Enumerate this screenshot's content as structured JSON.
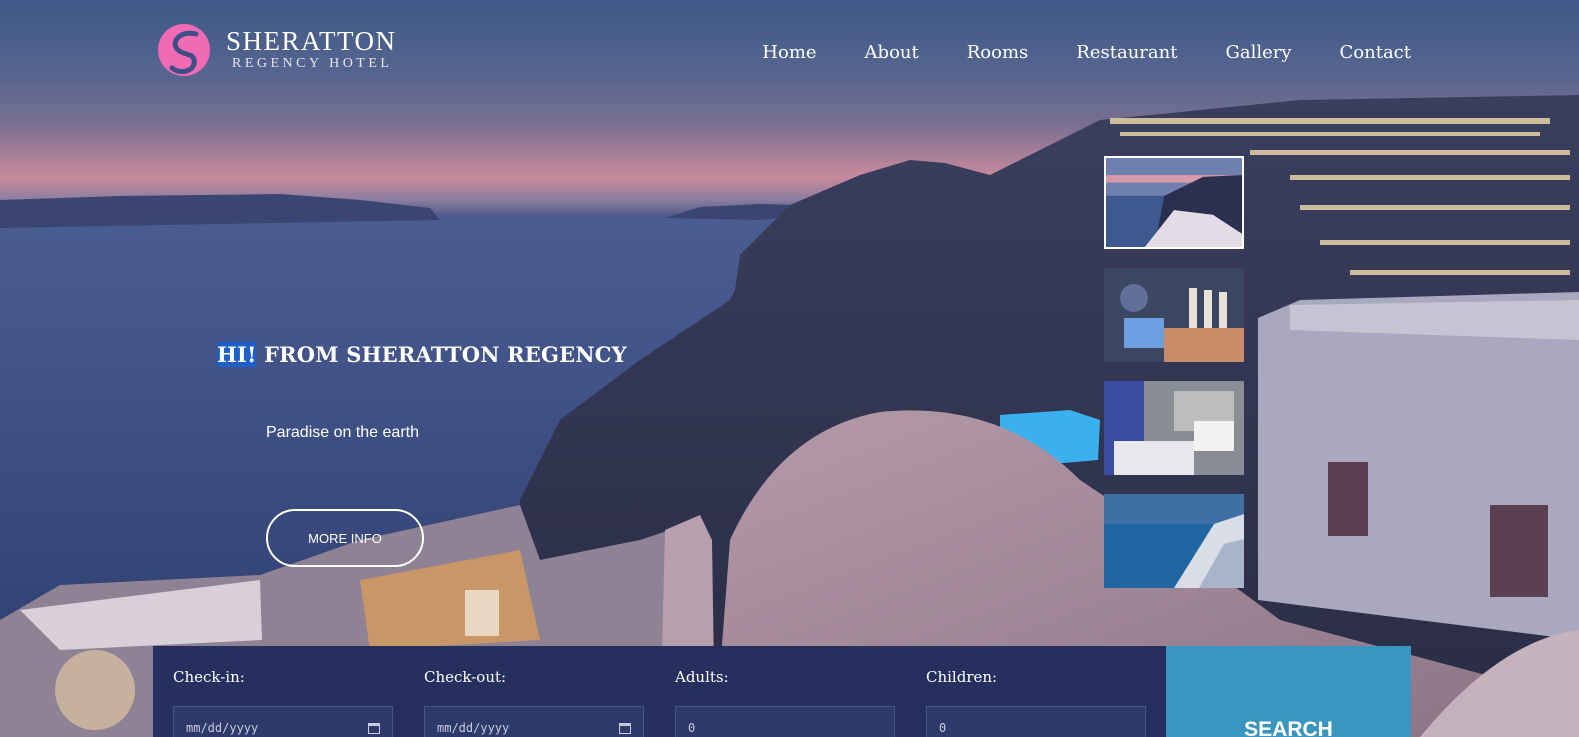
{
  "brand": {
    "name": "SHERATTON",
    "tagline": "REGENCY HOTEL",
    "accent_color": "#f06bb4"
  },
  "nav": {
    "items": [
      {
        "label": "Home"
      },
      {
        "label": "About"
      },
      {
        "label": "Rooms"
      },
      {
        "label": "Restaurant"
      },
      {
        "label": "Gallery"
      },
      {
        "label": "Contact"
      }
    ]
  },
  "hero": {
    "title_highlight": "HI!",
    "title_rest": " FROM SHERATTON REGENCY",
    "subtitle": "Paradise on the earth",
    "cta_label": "MORE INFO"
  },
  "gallery_thumbs": [
    {
      "icon": "santorini-sunset-thumbnail",
      "active": true
    },
    {
      "icon": "restaurant-glasses-thumbnail",
      "active": false
    },
    {
      "icon": "hotel-room-thumbnail",
      "active": false
    },
    {
      "icon": "santorini-coast-thumbnail",
      "active": false
    }
  ],
  "booking": {
    "checkin_label": "Check-in:",
    "checkin_placeholder": "mm/dd/yyyy",
    "checkout_label": "Check-out:",
    "checkout_placeholder": "mm/dd/yyyy",
    "adults_label": "Adults:",
    "adults_value": "0",
    "children_label": "Children:",
    "children_value": "0",
    "search_label": "SEARCH",
    "bar_color": "#26305e",
    "search_color": "#3b96bf"
  }
}
